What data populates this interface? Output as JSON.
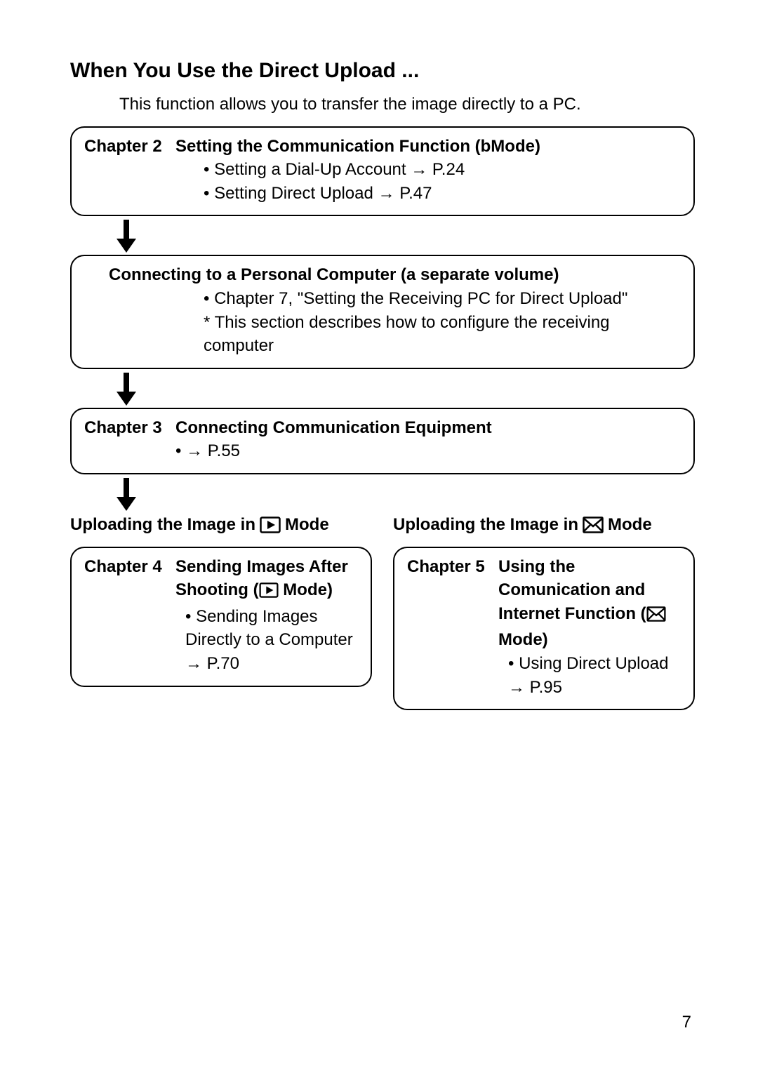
{
  "heading": "When You Use the Direct Upload ...",
  "intro": "This function allows you to transfer the image directly to a PC.",
  "box1": {
    "chapter_label": "Chapter 2",
    "chapter_title": "Setting the Communication Function (bMode)",
    "item1": "• Setting a Dial-Up Account → P.24",
    "item2": "• Setting Direct Upload → P.47"
  },
  "box2": {
    "title": "Connecting to a Personal Computer (a separate volume)",
    "item1": "• Chapter 7, \"Setting the Receiving PC for Direct Upload\"",
    "item2": "* This section describes how to configure the receiving computer"
  },
  "box3": {
    "chapter_label": "Chapter 3",
    "chapter_title": "Connecting Communication Equipment",
    "item1": "• → P.55"
  },
  "left": {
    "heading_pre": "Uploading the Image in",
    "heading_post": "Mode",
    "chapter_label": "Chapter 4",
    "chapter_title_pre": "Sending Images After Shooting (",
    "chapter_title_post": " Mode)",
    "item1": "• Sending Images Directly to a Computer → P.70"
  },
  "right": {
    "heading_pre": "Uploading the Image in",
    "heading_post": "Mode",
    "chapter_label": "Chapter 5",
    "chapter_title_pre": "Using the Comunication and Internet Function (",
    "chapter_title_post": " Mode)",
    "item1": "• Using Direct Upload → P.95"
  },
  "page_number": "7"
}
